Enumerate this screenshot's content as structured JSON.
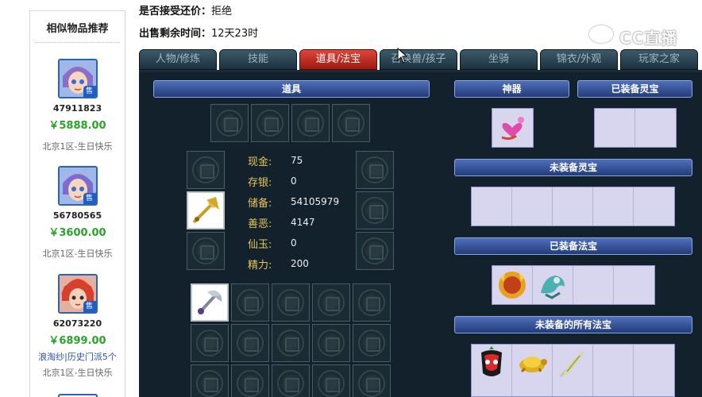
{
  "sidebar": {
    "title": "相似物品推荐",
    "items": [
      {
        "id": "47911823",
        "price": "￥5888.00",
        "tag": "",
        "server": "北京1区-生日快乐",
        "badge": "售"
      },
      {
        "id": "56780565",
        "price": "￥3600.00",
        "tag": "",
        "server": "北京1区-生日快乐",
        "badge": "售"
      },
      {
        "id": "62073220",
        "price": "￥6899.00",
        "tag": "浪淘纱|历史门派5个",
        "server": "北京1区-生日快乐",
        "badge": "售"
      }
    ]
  },
  "info": {
    "counter_offer_label": "是否接受还价：",
    "counter_offer_value": "拒绝",
    "time_left_label": "出售剩余时间：",
    "time_left_value": "12天23时"
  },
  "watermark": {
    "text": "CC直播"
  },
  "tabs": [
    {
      "label": "人物/修炼",
      "active": false
    },
    {
      "label": "技能",
      "active": false
    },
    {
      "label": "道具/法宝",
      "active": true
    },
    {
      "label": "召唤兽/孩子",
      "active": false
    },
    {
      "label": "坐骑",
      "active": false
    },
    {
      "label": "锦衣/外观",
      "active": false
    },
    {
      "label": "玩家之家",
      "active": false
    }
  ],
  "panel": {
    "items_header": "道具",
    "shenqi_header": "神器",
    "equipped_lingbao_header": "已装备灵宝",
    "unequipped_lingbao_header": "未装备灵宝",
    "equipped_fabao_header": "已装备法宝",
    "unequipped_fabao_header": "未装备的所有法宝",
    "stats": [
      {
        "label": "现金:",
        "value": "75"
      },
      {
        "label": "存银:",
        "value": "0"
      },
      {
        "label": "储备:",
        "value": "54105979"
      },
      {
        "label": "善恶:",
        "value": "4147"
      },
      {
        "label": "仙玉:",
        "value": "0"
      },
      {
        "label": "精力:",
        "value": "200"
      }
    ]
  },
  "colors": {
    "active_tab": "#c8281c",
    "price_green": "#28a428",
    "panel_bg": "#12212b",
    "lavender_cell": "#d8d6ef",
    "stat_label": "#e8c55a"
  }
}
